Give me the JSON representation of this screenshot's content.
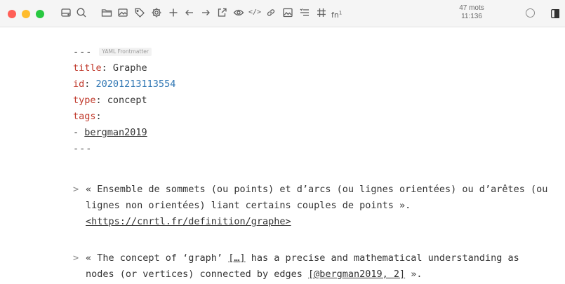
{
  "toolbar": {
    "traffic_lights": {
      "close_color": "#ff5f57",
      "minimize_color": "#febc2e",
      "zoom_color": "#28c840"
    },
    "icons": [
      "hard-drive-icon",
      "search-icon",
      "folder-icon",
      "image-icon",
      "tag-icon",
      "gear-icon",
      "plus-icon",
      "arrow-left-icon",
      "arrow-right-icon",
      "export-icon",
      "eye-icon",
      "code-icon",
      "link-icon",
      "insert-image-icon",
      "list-icon",
      "table-icon",
      "footnote-icon"
    ],
    "code_glyph": "</>",
    "footnote_glyph": "fn",
    "footnote_sup": "1",
    "word_count": "47 mots",
    "char_count": "11:136"
  },
  "editor": {
    "frontmatter_delimiter": "---",
    "frontmatter_badge": "YAML Frontmatter",
    "title_key": "title",
    "title_value": "Graphe",
    "id_key": "id",
    "id_value": "20201213113554",
    "type_key": "type",
    "type_value": "concept",
    "tags_key": "tags",
    "tag_item_prefix": "- ",
    "tag_item": "bergman2019",
    "quote_marker": ">",
    "quote1_text": "« Ensemble de sommets (ou points) et d’arcs (ou lignes orientées) ou d’arêtes (ou lignes non orientées) liant certains couples de points ».",
    "quote1_link": "<https://cnrtl.fr/definition/graphe>",
    "quote2_text_before": "« The concept of ‘graph’ ",
    "quote2_ellipsis": "[…]",
    "quote2_text_middle": " has a precise and mathematical understanding as nodes (or vertices) connected by edges ",
    "quote2_citation": "[@bergman2019, 2]",
    "quote2_text_after": " »."
  }
}
